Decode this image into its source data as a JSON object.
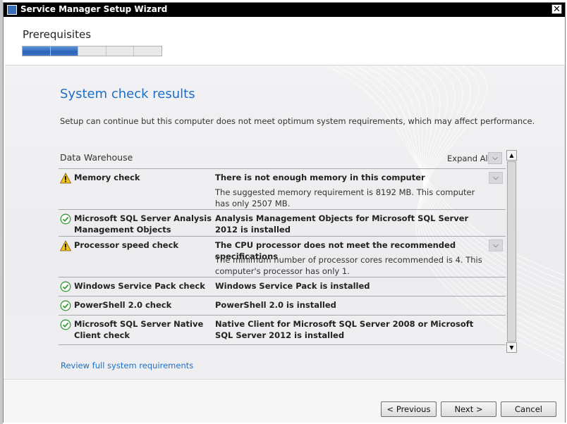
{
  "window": {
    "title": "Service Manager Setup Wizard",
    "close_glyph": "✕"
  },
  "header": {
    "page_title": "Prerequisites",
    "progress": {
      "total_steps": 5,
      "completed_steps": 2
    }
  },
  "content": {
    "section_title": "System check results",
    "intro": "Setup can continue but this computer does not meet optimum system requirements, which may affect performance.",
    "group_label": "Data Warehouse",
    "expand_all_label": "Expand All",
    "results": [
      {
        "icon": "warning-icon",
        "name": "Memory check",
        "status": "There is not enough memory in this computer",
        "detail": "The suggested memory requirement is 8192 MB. This computer has only 2507 MB.",
        "expandable": true
      },
      {
        "icon": "check-circle-icon",
        "name": "Microsoft SQL Server Analysis Management Objects",
        "status": "Analysis Management Objects for Microsoft SQL Server 2012 is installed",
        "detail": "",
        "expandable": false
      },
      {
        "icon": "warning-icon",
        "name": "Processor speed check",
        "status": "The CPU processor does not meet the recommended specifications",
        "detail": "The minimum number of processor cores recommended is 4. This computer's processor has only 1.",
        "expandable": true
      },
      {
        "icon": "check-circle-icon",
        "name": "Windows Service Pack check",
        "status": "Windows Service Pack is installed",
        "detail": "",
        "expandable": false
      },
      {
        "icon": "check-circle-icon",
        "name": "PowerShell 2.0 check",
        "status": "PowerShell 2.0 is installed",
        "detail": "",
        "expandable": false
      },
      {
        "icon": "check-circle-icon",
        "name": "Microsoft SQL Server Native Client check",
        "status": "Native Client for Microsoft SQL Server 2008 or Microsoft SQL Server 2012 is installed",
        "detail": "",
        "expandable": false
      }
    ],
    "review_link": "Review full system requirements"
  },
  "footer": {
    "previous_label": "< Previous",
    "next_label": "Next >",
    "cancel_label": "Cancel"
  },
  "colors": {
    "accent_blue": "#1d6ec6",
    "progress_blue": "#2a62b7",
    "warning_yellow": "#f3c21c",
    "success_green": "#3a9a3a"
  }
}
